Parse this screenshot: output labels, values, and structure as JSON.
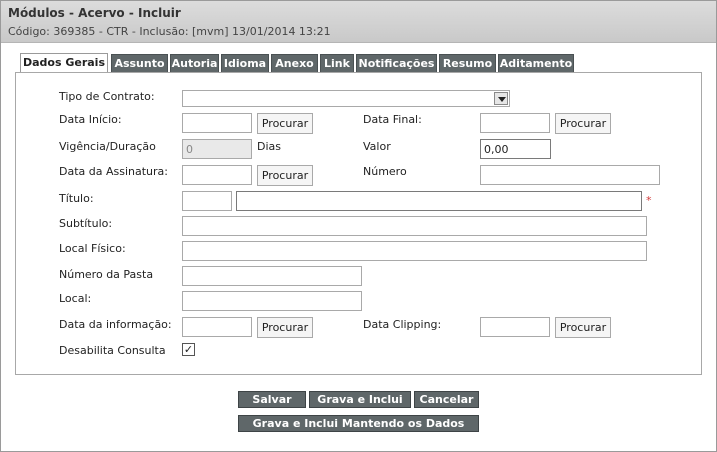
{
  "header": {
    "title": "Módulos - Acervo - Incluir",
    "subtitle": "Código: 369385 - CTR - Inclusão: [mvm] 13/01/2014 13:21"
  },
  "tabs": [
    "Dados Gerais",
    "Assunto",
    "Autoria",
    "Idioma",
    "Anexo",
    "Link",
    "Notificações",
    "Resumo",
    "Aditamento"
  ],
  "active_tab": "Dados Gerais",
  "form": {
    "tipo_contrato_label": "Tipo de Contrato:",
    "tipo_contrato_value": "",
    "data_inicio_label": "Data Início:",
    "data_inicio_value": "",
    "data_final_label": "Data Final:",
    "data_final_value": "",
    "vigencia_label": "Vigência/Duração",
    "vigencia_value": "0",
    "dias_label": "Dias",
    "valor_label": "Valor",
    "valor_value": "0,00",
    "data_assinatura_label": "Data da Assinatura:",
    "data_assinatura_value": "",
    "numero_label": "Número",
    "numero_value": "",
    "titulo_label": "Título:",
    "titulo_prefix_value": "",
    "titulo_value": "",
    "required_mark": "*",
    "subtitulo_label": "Subtítulo:",
    "subtitulo_value": "",
    "local_fisico_label": "Local Físico:",
    "local_fisico_value": "",
    "numero_pasta_label": "Número da Pasta",
    "numero_pasta_value": "",
    "local_label": "Local:",
    "local_value": "",
    "data_informacao_label": "Data da informação:",
    "data_informacao_value": "",
    "data_clipping_label": "Data Clipping:",
    "data_clipping_value": "",
    "desabilita_consulta_label": "Desabilita Consulta",
    "desabilita_consulta_checked": "✓",
    "procurar_label": "Procurar"
  },
  "actions": {
    "salvar": "Salvar",
    "grava_inclui": "Grava e Inclui",
    "cancelar": "Cancelar",
    "grava_inclui_mantendo": "Grava e Inclui Mantendo os Dados"
  },
  "colors": {
    "tab_bg": "#5f6769",
    "header_bg": "#d2d2d2",
    "required": "#d23a3a"
  }
}
